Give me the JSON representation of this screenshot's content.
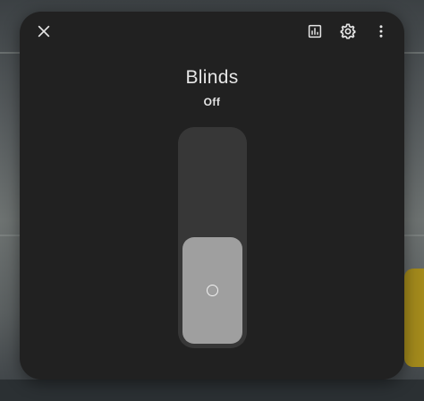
{
  "dialog": {
    "title": "Blinds",
    "state": "Off"
  },
  "header": {
    "close_icon": "close-icon",
    "history_icon": "chart-box-icon",
    "settings_icon": "gear-icon",
    "more_icon": "dots-vertical-icon"
  },
  "slider": {
    "position_percent": 50,
    "handle_icon": "circle-outline-icon"
  },
  "colors": {
    "dialog_bg": "#212121",
    "track": "#373737",
    "fill": "#9f9f9f",
    "text": "#e6e6e6"
  }
}
